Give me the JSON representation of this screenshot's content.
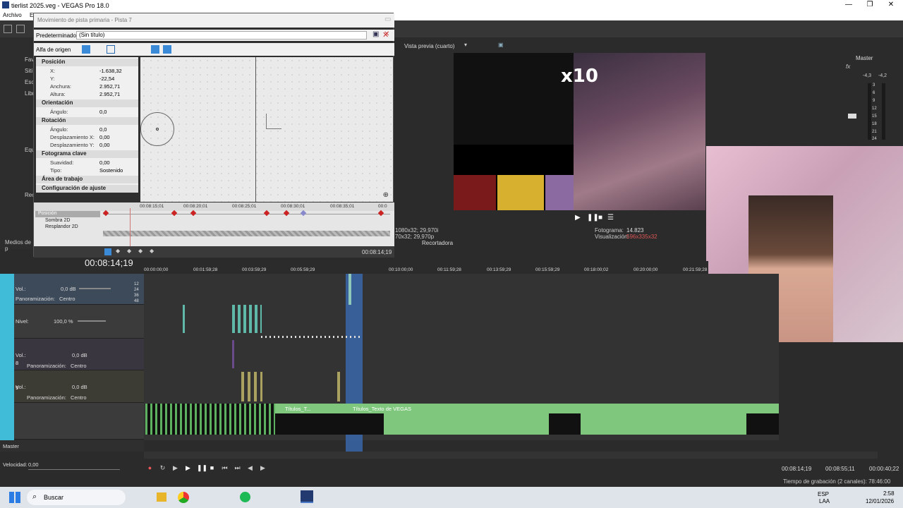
{
  "window": {
    "title": "tierlist 2025.veg - VEGAS Pro 18.0"
  },
  "menu": {
    "archivo": "Archivo",
    "second": "E"
  },
  "explorer": {
    "items": [
      "Fav",
      "Siti",
      "Esc",
      "Libr",
      "Equ",
      "Rec"
    ],
    "medios": "Medios de p"
  },
  "dialog": {
    "title": "Movimiento de pista primaria - Pista 7",
    "preset_label": "Predeterminado:",
    "preset_value": "(Sin título)",
    "source_alpha": "Alfa de origen",
    "sections": {
      "posicion": "Posición",
      "orientacion": "Orientación",
      "rotacion": "Rotación",
      "fotograma": "Fotograma clave",
      "area": "Área de trabajo",
      "config": "Configuración de ajuste"
    },
    "props": {
      "x_label": "X:",
      "x_val": "-1.638,32",
      "y_label": "Y:",
      "y_val": "-22,54",
      "w_label": "Anchura:",
      "w_val": "2.952,71",
      "h_label": "Altura:",
      "h_val": "2.952,71",
      "ang_label": "Ángulo:",
      "ang_val": "0,0",
      "rang_label": "Ángulo:",
      "rang_val": "0,0",
      "dx_label": "Desplazamiento X:",
      "dx_val": "0,00",
      "dy_label": "Desplazamiento Y:",
      "dy_val": "0,00",
      "suav_label": "Suavidad:",
      "suav_val": "0,00",
      "tipo_label": "Tipo:",
      "tipo_val": "Sostenido"
    },
    "keyframe_tracks": [
      "Posición",
      "Sombra 2D",
      "Resplandor 2D"
    ],
    "ruler": [
      "00:08:15;01",
      "00:08:20;01",
      "00:08:25;01",
      "00:08:30;01",
      "00:08:35;01",
      "00:0"
    ],
    "time": "00:08:14;19"
  },
  "preview": {
    "label": "Vista previa (cuarto)",
    "res_left1": "1080x32; 29,970i",
    "res_left2": "70x32; 29,970p",
    "frame_label": "Fotograma:",
    "frame_val": "14.823",
    "vis_label": "Visualización:",
    "vis_val": "596x335x32",
    "recortadora": "Recortadora",
    "overlay_text": "x10"
  },
  "master": {
    "label": "Master",
    "levels": [
      "-4,3",
      "-4,2"
    ],
    "scale": [
      "3",
      "6",
      "9",
      "12",
      "15",
      "18",
      "21",
      "24"
    ]
  },
  "timeline": {
    "cursor_time": "00:08:14;19",
    "ruler": [
      "00:00:00;00",
      "00:01:59;28",
      "00:03:59;29",
      "00:05:59;29",
      "00:10:00;00",
      "00:11:59;28",
      "00:13:59;29",
      "00:15:59;29",
      "00:18:00;02",
      "00:20:00;00",
      "00:21:59;28"
    ]
  },
  "tracks": {
    "t1_vol_label": "Vol.:",
    "t1_vol": "0,0 dB",
    "t1_pan_label": "Panoramización:",
    "t1_pan": "Centro",
    "t2_level_label": "Nivel:",
    "t2_level": "100,0 %",
    "t3_num": "8",
    "t3_vol_label": "Vol.:",
    "t3_vol": "0,0 dB",
    "t3_pan_label": "Panoramización:",
    "t3_pan": "Centro",
    "t4_num": "9",
    "t4_vol_label": "Vol.:",
    "t4_vol": "0,0 dB",
    "t4_pan_label": "Panoramización:",
    "t4_pan": "Centro",
    "db_scale": [
      "12",
      "24",
      "36",
      "48"
    ],
    "clip1": "Títulos_T...",
    "clip2": "Títulos_Texto de VEGAS",
    "master_label": "Master",
    "speed_label": "Velocidad:",
    "speed_val": "0,00"
  },
  "transport": {
    "time1": "00:08:14;19",
    "time2": "00:08:55;11",
    "time3": "00:00:40;22"
  },
  "status": {
    "recording": "Tiempo de grabación (2 canales): 78:46:00"
  },
  "taskbar": {
    "search": "Buscar",
    "lang1": "ESP",
    "lang2": "LAA",
    "clock": "2:58",
    "date": "12/01/2026"
  }
}
